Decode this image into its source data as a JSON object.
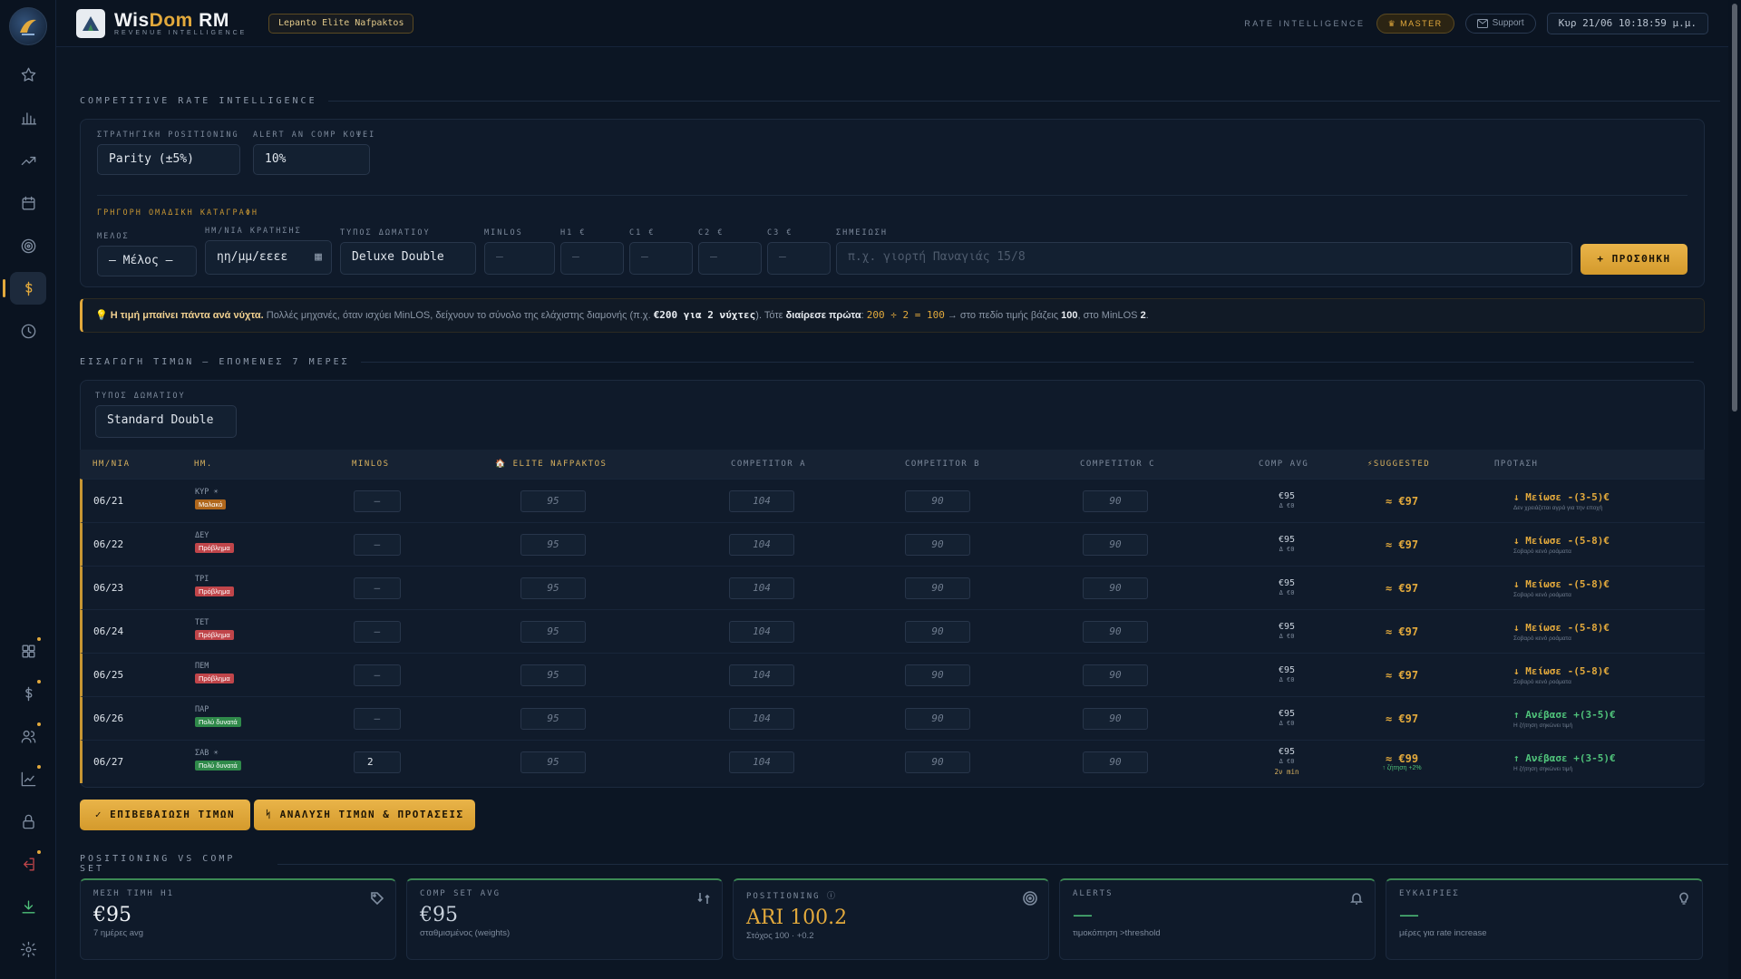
{
  "header": {
    "brand_a": "Wis",
    "brand_b": "Dom",
    "brand_c": " RM",
    "brand_sub": "REVENUE INTELLIGENCE",
    "hotel": "Lepanto Elite Nafpaktos",
    "rate_label": "RATE INTELLIGENCE",
    "master": "♛ MASTER",
    "support": "Support",
    "datetime": "Κυρ 21/06 10:18:59 μ.μ."
  },
  "section1": {
    "title": "COMPETITIVE RATE INTELLIGENCE",
    "positioning_label": "ΣΤΡΑΤΗΓΙΚΗ POSITIONING",
    "positioning_value": "Parity (±5%)",
    "alert_label": "ALERT AN COMP ΚΟΨΕΙ",
    "alert_value": "10%",
    "quick_label": "ΓΡΗΓΟΡΗ ΟΜΑΔΙΚΗ ΚΑΤΑΓΡΑΦΗ",
    "member_label": "ΜΕΛΟΣ",
    "member_value": "— Μέλος —",
    "date_label": "ΗΜ/ΝΙΑ ΚΡΑΤΗΣΗΣ",
    "date_value": "ηη/μμ/εεεε",
    "room_label": "ΤΥΠΟΣ ΔΩΜΑΤΙΟΥ",
    "room_value": "Deluxe Double",
    "minlos_label": "MINLOS",
    "h1_label": "H1 €",
    "c1_label": "C1 €",
    "c2_label": "C2 €",
    "c3_label": "C3 €",
    "dash": "—",
    "note_label": "ΣΗΜΕΙΩΣΗ",
    "note_placeholder": "π.χ. γιορτή Παναγιάς 15/8",
    "add_button": "+ ΠΡΟΣΘΗΚΗ"
  },
  "tip": {
    "bulb": "💡",
    "bold": "Η τιμή μπαίνει πάντα ανά νύχτα.",
    "text1": " Πολλές μηχανές, όταν ισχύει MinLOS, δείχνουν το σύνολο της ελάχιστης διαμονής (π.χ. ",
    "ex": "€200 για 2 νύχτες",
    "text2": "). Τότε ",
    "bold2": "διαίρεσε πρώτα",
    "text3": ": ",
    "formula": "200 ÷ 2 = 100",
    "text4": " → στο πεδίο τιμής βάζεις ",
    "v1": "100",
    "text5": ", στο MinLOS ",
    "v2": "2",
    "text6": "."
  },
  "section2": {
    "title": "ΕΙΣΑΓΩΓΗ ΤΙΜΩΝ — ΕΠΟΜΕΝΕΣ 7 ΜΕΡΕΣ",
    "room_label": "ΤΥΠΟΣ ΔΩΜΑΤΙΟΥ",
    "room_value": "Standard Double",
    "columns": [
      "ΗΜ/ΝΙΑ",
      "ΗΜ.",
      "MINLOS",
      "🏠 ELITE NAFPAKTOS",
      "COMPETITOR A",
      "COMPETITOR B",
      "COMPETITOR C",
      "COMP AVG",
      "⚡SUGGESTED",
      "ΠΡΟΤΑΣΗ"
    ],
    "rows": [
      {
        "date": "06/21",
        "day": "ΚΥΡ ☀",
        "tag": "Μαλακό",
        "tagc": "orange",
        "minlos": "—",
        "elite": "95",
        "a": "104",
        "b": "90",
        "c": "90",
        "avg": "€95",
        "avg_sub": "Δ €0",
        "avg_sub2": "",
        "sugg": "≈ €97",
        "sugg_sub": "",
        "prop": "↓ Μείωσε -(3-5)€",
        "prop_sub": "Δεν χρειάζεται αγρά για την εποχή",
        "dir": "down"
      },
      {
        "date": "06/22",
        "day": "ΔΕΥ",
        "tag": "Πρόβλημα",
        "tagc": "red",
        "minlos": "—",
        "elite": "95",
        "a": "104",
        "b": "90",
        "c": "90",
        "avg": "€95",
        "avg_sub": "Δ €0",
        "avg_sub2": "",
        "sugg": "≈ €97",
        "sugg_sub": "",
        "prop": "↓ Μείωσε -(5-8)€",
        "prop_sub": "Σοβαρό κενό ροάματα",
        "dir": "down"
      },
      {
        "date": "06/23",
        "day": "ΤΡΙ",
        "tag": "Πρόβλημα",
        "tagc": "red",
        "minlos": "—",
        "elite": "95",
        "a": "104",
        "b": "90",
        "c": "90",
        "avg": "€95",
        "avg_sub": "Δ €0",
        "avg_sub2": "",
        "sugg": "≈ €97",
        "sugg_sub": "",
        "prop": "↓ Μείωσε -(5-8)€",
        "prop_sub": "Σοβαρό κενό ροάματα",
        "dir": "down"
      },
      {
        "date": "06/24",
        "day": "ΤΕΤ",
        "tag": "Πρόβλημα",
        "tagc": "red",
        "minlos": "—",
        "elite": "95",
        "a": "104",
        "b": "90",
        "c": "90",
        "avg": "€95",
        "avg_sub": "Δ €0",
        "avg_sub2": "",
        "sugg": "≈ €97",
        "sugg_sub": "",
        "prop": "↓ Μείωσε -(5-8)€",
        "prop_sub": "Σοβαρό κενό ροάματα",
        "dir": "down"
      },
      {
        "date": "06/25",
        "day": "ΠΕΜ",
        "tag": "Πρόβλημα",
        "tagc": "red",
        "minlos": "—",
        "elite": "95",
        "a": "104",
        "b": "90",
        "c": "90",
        "avg": "€95",
        "avg_sub": "Δ €0",
        "avg_sub2": "",
        "sugg": "≈ €97",
        "sugg_sub": "",
        "prop": "↓ Μείωσε -(5-8)€",
        "prop_sub": "Σοβαρό κενό ροάματα",
        "dir": "down"
      },
      {
        "date": "06/26",
        "day": "ΠΑΡ",
        "tag": "Πολύ δυνατά",
        "tagc": "green",
        "minlos": "—",
        "elite": "95",
        "a": "104",
        "b": "90",
        "c": "90",
        "avg": "€95",
        "avg_sub": "Δ €0",
        "avg_sub2": "",
        "sugg": "≈ €97",
        "sugg_sub": "",
        "prop": "↑ Ανέβασε +(3-5)€",
        "prop_sub": "Η ζήτηση σηκώνει τιμή",
        "dir": "up"
      },
      {
        "date": "06/27",
        "day": "ΣΑΒ ☀",
        "tag": "Πολύ δυνατά",
        "tagc": "green",
        "minlos": "2",
        "elite": "95",
        "a": "104",
        "b": "90",
        "c": "90",
        "avg": "€95",
        "avg_sub": "Δ €0",
        "avg_sub2": "2ν min",
        "sugg": "≈ €99",
        "sugg_sub": "↑ ζήτηση +2%",
        "prop": "↑ Ανέβασε +(3-5)€",
        "prop_sub": "Η ζήτηση σηκώνει τιμή",
        "dir": "up"
      }
    ],
    "confirm_button": "✓ ΕΠΙΒΕΒΑΙΩΣΗ ΤΙΜΩΝ",
    "analysis_button": "ᛋ ΑΝΑΛΥΣΗ ΤΙΜΩΝ & ΠΡΟΤΑΣΕΙΣ"
  },
  "section3": {
    "title": "POSITIONING VS COMP SET",
    "cards": [
      {
        "title": "ΜΕΣΗ ΤΙΜΗ H1",
        "value": "€95",
        "sub": "7 ημέρες avg"
      },
      {
        "title": "COMP SET AVG",
        "value": "€95",
        "sub": "σταθμισμένος (weights)"
      },
      {
        "title": "POSITIONING ⓘ",
        "value": "ARI 100.2",
        "sub": "Στόχος 100 · +0.2"
      },
      {
        "title": "ALERTS",
        "value": "—",
        "sub": "τιμοκόπηση >threshold"
      },
      {
        "title": "ΕΥΚΑΙΡΙΕΣ",
        "value": "—",
        "sub": "μέρες για rate increase"
      }
    ]
  }
}
